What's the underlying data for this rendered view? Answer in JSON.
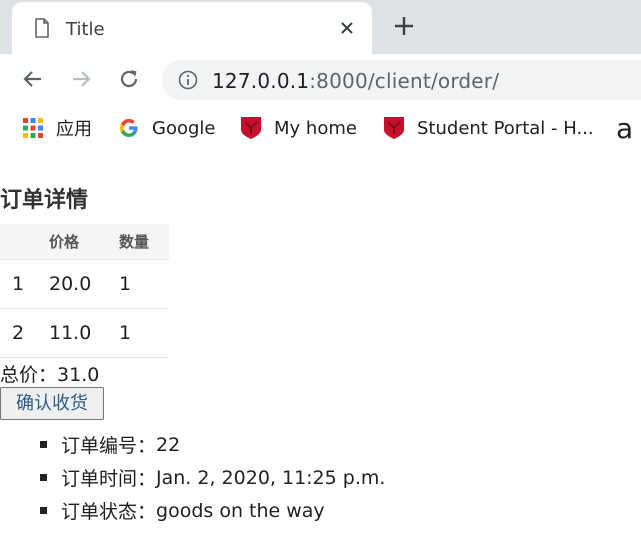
{
  "browser": {
    "tab": {
      "title": "Title"
    },
    "address": {
      "host": "127.0.0.1",
      "path": ":8000/client/order/"
    },
    "bookmarks": [
      {
        "label": "应用",
        "icon": "apps-grid-icon"
      },
      {
        "label": "Google",
        "icon": "google-icon"
      },
      {
        "label": "My home",
        "icon": "shield-icon"
      },
      {
        "label": "Student Portal - H...",
        "icon": "shield-icon"
      }
    ],
    "bookmarks_overflow": "a"
  },
  "order": {
    "heading": "订单详情",
    "table": {
      "headers": [
        "",
        "价格",
        "数量"
      ],
      "rows": [
        [
          "1",
          "20.0",
          "1"
        ],
        [
          "2",
          "11.0",
          "1"
        ]
      ]
    },
    "total_label": "总价：",
    "total_value": "31.0",
    "confirm_button": "确认收货",
    "details": [
      {
        "label": "订单编号：",
        "value": "22"
      },
      {
        "label": "订单时间：",
        "value": "Jan. 2, 2020, 11:25 p.m."
      },
      {
        "label": "订单状态：",
        "value": "goods on the way"
      }
    ]
  },
  "colors": {
    "tabstrip": "#dee1e6",
    "omnibox": "#f1f3f4",
    "button_text": "#2c5c8a",
    "bookmark_red": "#c8102e"
  }
}
